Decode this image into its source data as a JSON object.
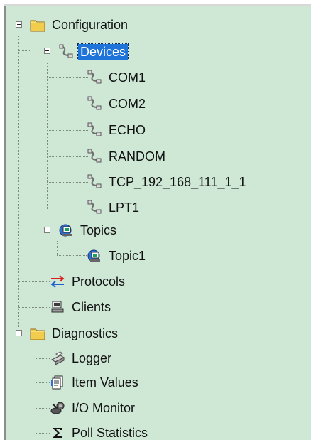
{
  "tree": {
    "configuration": {
      "label": "Configuration",
      "icon": "folder-icon"
    },
    "devices": {
      "label": "Devices",
      "icon": "device-cable-icon",
      "selected": true,
      "items": [
        {
          "label": "COM1",
          "icon": "device-cable-icon"
        },
        {
          "label": "COM2",
          "icon": "device-cable-icon"
        },
        {
          "label": "ECHO",
          "icon": "device-cable-icon"
        },
        {
          "label": "RANDOM",
          "icon": "device-cable-icon"
        },
        {
          "label": "TCP_192_168_111_1_1",
          "icon": "device-cable-icon"
        },
        {
          "label": "LPT1",
          "icon": "device-cable-icon"
        }
      ]
    },
    "topics": {
      "label": "Topics",
      "icon": "topic-computer-icon",
      "items": [
        {
          "label": "Topic1",
          "icon": "topic-computer-icon"
        }
      ]
    },
    "protocols": {
      "label": "Protocols",
      "icon": "protocol-arrows-icon"
    },
    "clients": {
      "label": "Clients",
      "icon": "client-computer-icon"
    },
    "diagnostics": {
      "label": "Diagnostics",
      "icon": "folder-icon",
      "items": [
        {
          "label": "Logger",
          "icon": "logger-printer-icon"
        },
        {
          "label": "Item Values",
          "icon": "item-values-icon"
        },
        {
          "label": "I/O Monitor",
          "icon": "io-monitor-icon"
        },
        {
          "label": "Poll Statistics",
          "icon": "sigma-icon"
        }
      ]
    }
  },
  "colors": {
    "background": "#cfe8d6",
    "selection": "#1e74d8",
    "folder": "#e8c34f",
    "text": "#111111"
  }
}
